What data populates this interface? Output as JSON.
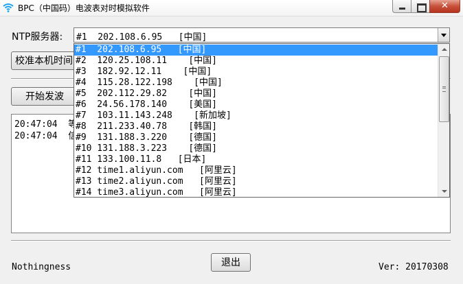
{
  "window": {
    "title": "BPC（中国码）电波表对时模拟软件",
    "close_glyph": "✕"
  },
  "ntp": {
    "label": "NTP服务器:",
    "selected": "#1  202.108.6.95   [中国]"
  },
  "buttons": {
    "calibrate": "校准本机时间",
    "start": "开始发波",
    "exit": "退出"
  },
  "log": [
    "20:47:04  等",
    "20:47:04  信"
  ],
  "status": {
    "left": "Nothingness",
    "right": "Ver: 20170308"
  },
  "servers": [
    "#1  202.108.6.95   [中国]",
    "#2  120.25.108.11    [中国]",
    "#3  182.92.12.11    [中国]",
    "#4  115.28.122.198    [中国]",
    "#5  202.112.29.82    [中国]",
    "#6  24.56.178.140    [美国]",
    "#7  103.11.143.248    [新加坡]",
    "#8  211.233.40.78    [韩国]",
    "#9  131.188.3.220    [德国]",
    "#10 131.188.3.223    [德国]",
    "#11 133.100.11.8   [日本]",
    "#12 time1.aliyun.com   [阿里云]",
    "#13 time2.aliyun.com   [阿里云]",
    "#14 time3.aliyun.com   [阿里云]"
  ],
  "colors": {
    "selection": "#3399ff",
    "wifi_icon": "#1aa3e8"
  }
}
